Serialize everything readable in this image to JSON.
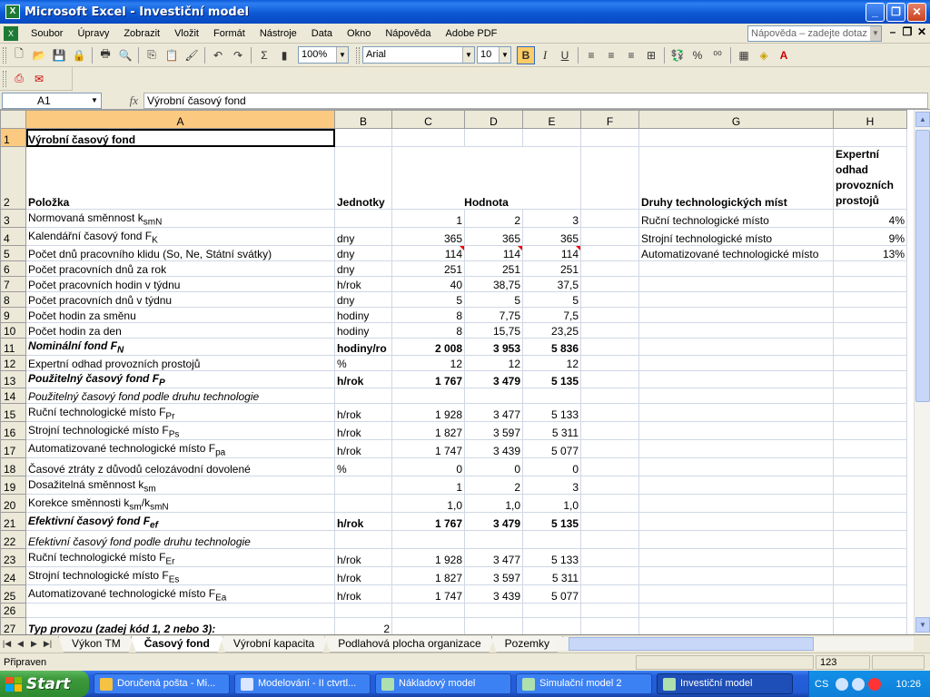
{
  "window": {
    "title": "Microsoft Excel - Investiční model",
    "app_icon": "excel-icon"
  },
  "menu": {
    "items": [
      "Soubor",
      "Úpravy",
      "Zobrazit",
      "Vložit",
      "Formát",
      "Nástroje",
      "Data",
      "Okno",
      "Nápověda",
      "Adobe PDF"
    ],
    "help_placeholder": "Nápověda – zadejte dotaz"
  },
  "toolbar": {
    "zoom": "100%",
    "font": "Arial",
    "size": "10",
    "sigma": "Σ",
    "percent": "%"
  },
  "formula_bar": {
    "cell_ref": "A1",
    "fx": "fx",
    "content": "Výrobní časový fond"
  },
  "grid": {
    "columns": [
      "A",
      "B",
      "C",
      "D",
      "E",
      "F",
      "G",
      "H"
    ],
    "rows": [
      {
        "n": "1",
        "a": "Výrobní časový fond",
        "b": "",
        "c": "",
        "d": "",
        "e": "",
        "f": "",
        "g": "",
        "h": ""
      },
      {
        "n": "2",
        "a": "Položka",
        "b": "Jednotky",
        "c": "Hodnota",
        "d": "",
        "e": "",
        "f": "",
        "g": "Druhy technologických míst",
        "h": "Expertní odhad provozních prostojů"
      },
      {
        "n": "3",
        "a": "Normovaná směnnost k",
        "a_sub": "smN",
        "b": "",
        "c": "1",
        "d": "2",
        "e": "3",
        "f": "",
        "g": "Ruční technologické místo",
        "h": "4%"
      },
      {
        "n": "4",
        "a": "Kalendářní časový fond F",
        "a_sub": "K",
        "b": "dny",
        "c": "365",
        "d": "365",
        "e": "365",
        "f": "",
        "g": "Strojní technologické místo",
        "h": "9%"
      },
      {
        "n": "5",
        "a": "Počet dnů pracovního klidu (So, Ne, Státní svátky)",
        "b": "dny",
        "c": "114",
        "d": "114",
        "e": "114",
        "f": "",
        "g": "Automatizované technologické místo",
        "h": "13%"
      },
      {
        "n": "6",
        "a": "Počet pracovních dnů za rok",
        "b": "dny",
        "c": "251",
        "d": "251",
        "e": "251",
        "f": "",
        "g": "",
        "h": ""
      },
      {
        "n": "7",
        "a": "Počet pracovních hodin v týdnu",
        "b": "h/rok",
        "c": "40",
        "d": "38,75",
        "e": "37,5",
        "f": "",
        "g": "",
        "h": ""
      },
      {
        "n": "8",
        "a": "Počet pracovních dnů v týdnu",
        "b": "dny",
        "c": "5",
        "d": "5",
        "e": "5",
        "f": "",
        "g": "",
        "h": ""
      },
      {
        "n": "9",
        "a": "Počet hodin za směnu",
        "b": "hodiny",
        "c": "8",
        "d": "7,75",
        "e": "7,5",
        "f": "",
        "g": "",
        "h": ""
      },
      {
        "n": "10",
        "a": "Počet hodin za den",
        "b": "hodiny",
        "c": "8",
        "d": "15,75",
        "e": "23,25",
        "f": "",
        "g": "",
        "h": ""
      },
      {
        "n": "11",
        "a": "Nominální fond F",
        "a_sub": "N",
        "b": "hodiny/ro",
        "c": "2 008",
        "d": "3 953",
        "e": "5 836",
        "f": "",
        "g": "",
        "h": ""
      },
      {
        "n": "12",
        "a": "Expertní odhad provozních prostojů",
        "b": "%",
        "c": "12",
        "d": "12",
        "e": "12",
        "f": "",
        "g": "",
        "h": ""
      },
      {
        "n": "13",
        "a": "Použitelný časový fond F",
        "a_sub": "P",
        "b": "h/rok",
        "c": "1 767",
        "d": "3 479",
        "e": "5 135",
        "f": "",
        "g": "",
        "h": ""
      },
      {
        "n": "14",
        "a": "Použitelný časový fond podle druhu technologie",
        "b": "",
        "c": "",
        "d": "",
        "e": "",
        "f": "",
        "g": "",
        "h": ""
      },
      {
        "n": "15",
        "a": "Ruční technologické místo F",
        "a_sub": "Pr",
        "b": "h/rok",
        "c": "1 928",
        "d": "3 477",
        "e": "5 133",
        "f": "",
        "g": "",
        "h": ""
      },
      {
        "n": "16",
        "a": "Strojní technologické místo F",
        "a_sub": "Ps",
        "b": "h/rok",
        "c": "1 827",
        "d": "3 597",
        "e": "5 311",
        "f": "",
        "g": "",
        "h": ""
      },
      {
        "n": "17",
        "a": "Automatizované technologické místo F",
        "a_sub": "pa",
        "b": "h/rok",
        "c": "1 747",
        "d": "3 439",
        "e": "5 077",
        "f": "",
        "g": "",
        "h": ""
      },
      {
        "n": "18",
        "a": "Časové ztráty z důvodů celozávodní dovolené",
        "b": "%",
        "c": "0",
        "d": "0",
        "e": "0",
        "f": "",
        "g": "",
        "h": ""
      },
      {
        "n": "19",
        "a": "Dosažitelná směnnost k",
        "a_sub": "sm",
        "b": "",
        "c": "1",
        "d": "2",
        "e": "3",
        "f": "",
        "g": "",
        "h": ""
      },
      {
        "n": "20",
        "a": "Korekce směnnosti k",
        "a_sub": "sm",
        "a_mid": "/k",
        "a_sub2": "smN",
        "b": "",
        "c": "1,0",
        "d": "1,0",
        "e": "1,0",
        "f": "",
        "g": "",
        "h": ""
      },
      {
        "n": "21",
        "a": "Efektivní časový fond F",
        "a_sub": "ef",
        "b": "h/rok",
        "c": "1 767",
        "d": "3 479",
        "e": "5 135",
        "f": "",
        "g": "",
        "h": ""
      },
      {
        "n": "22",
        "a": "Efektivní časový fond podle druhu technologie",
        "b": "",
        "c": "",
        "d": "",
        "e": "",
        "f": "",
        "g": "",
        "h": ""
      },
      {
        "n": "23",
        "a": "Ruční technologické místo F",
        "a_sub": "Er",
        "b": "h/rok",
        "c": "1 928",
        "d": "3 477",
        "e": "5 133",
        "f": "",
        "g": "",
        "h": ""
      },
      {
        "n": "24",
        "a": "Strojní technologické místo F",
        "a_sub": "Es",
        "b": "h/rok",
        "c": "1 827",
        "d": "3 597",
        "e": "5 311",
        "f": "",
        "g": "",
        "h": ""
      },
      {
        "n": "25",
        "a": "Automatizované technologické místo F",
        "a_sub": "Ea",
        "b": "h/rok",
        "c": "1 747",
        "d": "3 439",
        "e": "5 077",
        "f": "",
        "g": "",
        "h": ""
      },
      {
        "n": "26",
        "a": "",
        "b": "",
        "c": "",
        "d": "",
        "e": "",
        "f": "",
        "g": "",
        "h": ""
      },
      {
        "n": "27",
        "a": "Typ provozu (zadej kód 1, 2 nebo 3):",
        "b": "2",
        "c": "",
        "d": "",
        "e": "",
        "f": "",
        "g": "",
        "h": ""
      }
    ]
  },
  "sheet_tabs": [
    "Výkon TM",
    "Časový fond",
    "Výrobní kapacita",
    "Podlahová plocha organizace",
    "Pozemky"
  ],
  "active_tab": "Časový fond",
  "status": {
    "ready": "Připraven",
    "num": "123"
  },
  "taskbar": {
    "start": "Start",
    "items": [
      "Doručená pošta - Mi...",
      "Modelování - II ctvrtl...",
      "Nákladový model",
      "Simulační model 2",
      "Investiční model"
    ],
    "lang": "CS",
    "clock": "10:26"
  }
}
